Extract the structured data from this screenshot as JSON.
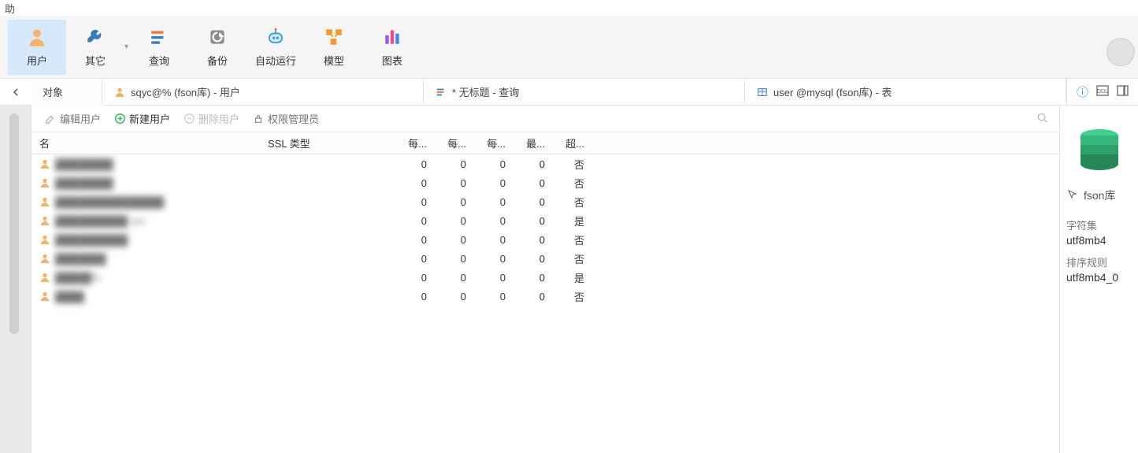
{
  "menu_corner": "助",
  "toolbar": [
    {
      "id": "user",
      "label": "用户",
      "active": true
    },
    {
      "id": "other",
      "label": "其它",
      "dropdown": true
    },
    {
      "id": "query",
      "label": "查询"
    },
    {
      "id": "backup",
      "label": "备份"
    },
    {
      "id": "auto",
      "label": "自动运行"
    },
    {
      "id": "model",
      "label": "模型"
    },
    {
      "id": "chart",
      "label": "图表"
    }
  ],
  "tabs": {
    "object": "对象",
    "t1": "sqyc@% (fson库) - 用户",
    "t2": "* 无标题 - 查询",
    "t3": "user @mysql (fson库) - 表"
  },
  "actions": {
    "edit": "编辑用户",
    "new": "新建用户",
    "delete": "删除用户",
    "priv": "权限管理员"
  },
  "columns": {
    "name": "名",
    "ssl": "SSL 类型",
    "c1": "每...",
    "c2": "每...",
    "c3": "每...",
    "c4": "最...",
    "c5": "超..."
  },
  "rows": [
    {
      "name": "████████",
      "v": [
        0,
        0,
        0,
        0
      ],
      "over": "否"
    },
    {
      "name": "████████",
      "v": [
        0,
        0,
        0,
        0
      ],
      "over": "否"
    },
    {
      "name": "███████████████",
      "v": [
        0,
        0,
        0,
        0
      ],
      "over": "否"
    },
    {
      "name": "██████████ ost",
      "v": [
        0,
        0,
        0,
        0
      ],
      "over": "是"
    },
    {
      "name": "██████████",
      "v": [
        0,
        0,
        0,
        0
      ],
      "over": "否"
    },
    {
      "name": "███████",
      "v": [
        0,
        0,
        0,
        0
      ],
      "over": "否"
    },
    {
      "name": "█████%",
      "v": [
        0,
        0,
        0,
        0
      ],
      "over": "是"
    },
    {
      "name": "████",
      "v": [
        0,
        0,
        0,
        0
      ],
      "over": "否"
    }
  ],
  "right": {
    "dbname": "fson库",
    "charset_label": "字符集",
    "charset": "utf8mb4",
    "collation_label": "排序规则",
    "collation": "utf8mb4_0"
  }
}
